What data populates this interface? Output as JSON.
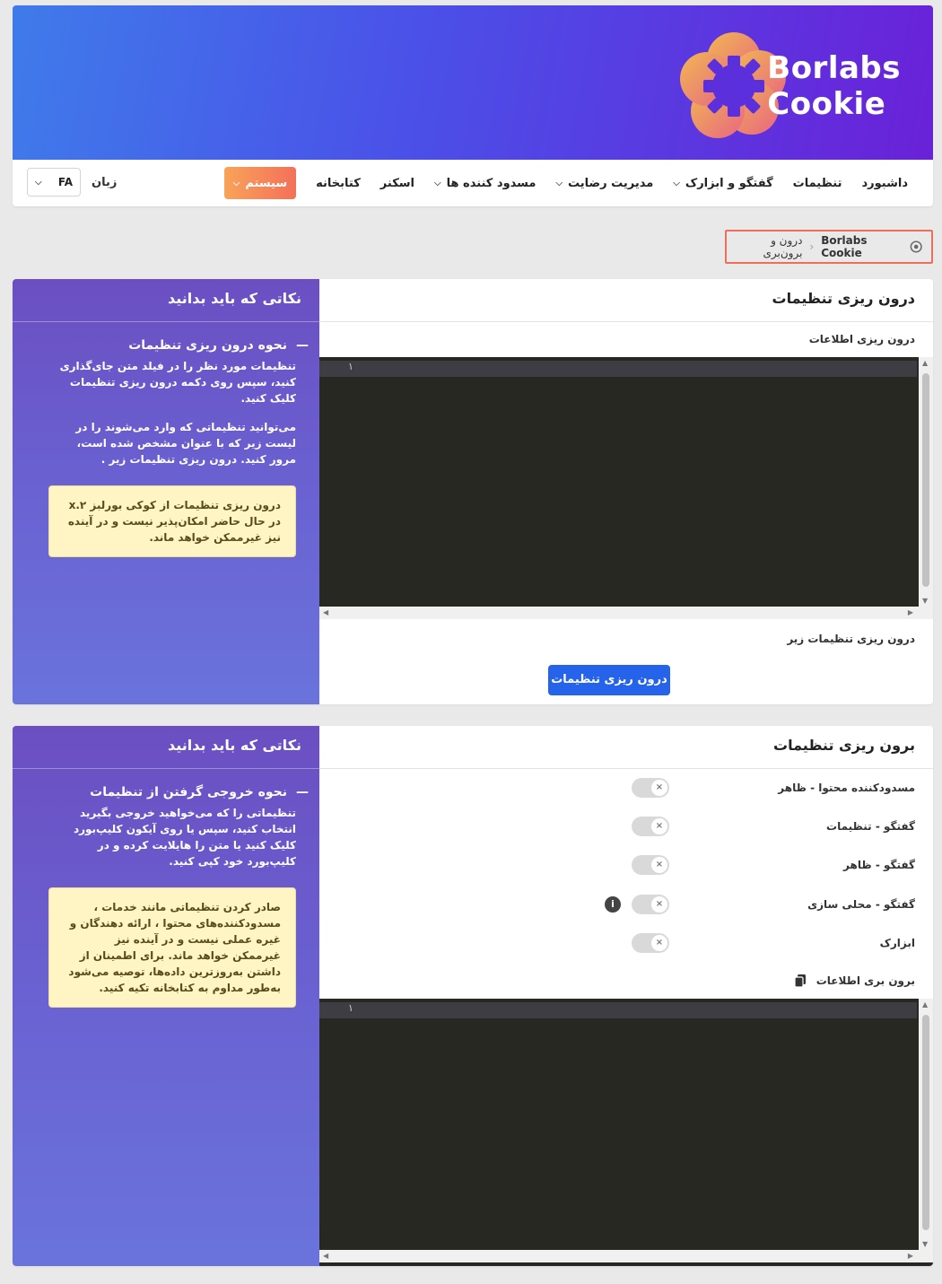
{
  "brand": {
    "name_line1": "Borlabs",
    "name_line2": "Cookie"
  },
  "nav": {
    "items": [
      {
        "label": "داشبورد",
        "dropdown": false,
        "active": false
      },
      {
        "label": "تنظیمات",
        "dropdown": false,
        "active": false
      },
      {
        "label": "گفتگو و ابزارک",
        "dropdown": true,
        "active": false
      },
      {
        "label": "مدیریت رضایت",
        "dropdown": true,
        "active": false
      },
      {
        "label": "مسدود کننده ها",
        "dropdown": true,
        "active": false
      },
      {
        "label": "اسکنر",
        "dropdown": false,
        "active": false
      },
      {
        "label": "کتابخانه",
        "dropdown": false,
        "active": false
      },
      {
        "label": "سیستم",
        "dropdown": true,
        "active": true
      }
    ],
    "language_label": "زبان",
    "language_value": "FA"
  },
  "breadcrumb": {
    "home": "Borlabs Cookie",
    "current": "درون و برون‌بری"
  },
  "import_card": {
    "title": "درون ریزی تنظیمات",
    "data_label": "درون ریزی اطلاعات",
    "line_number": "۱",
    "below_label": "درون ریزی تنظیمات زیر",
    "button_label": "درون ریزی تنظیمات",
    "side": {
      "title": "نکاتی که باید بدانید",
      "subtitle": "نحوه درون ریزی تنظیمات",
      "paragraph1": "تنظیمات مورد نظر را در فیلد متن جای‌گذاری کنید، سپس روی دکمه درون ریزی تنظیمات کلیک کنید.",
      "paragraph2": "می‌توانید تنظیماتی که وارد می‌شوند را در لیست زیر که با عنوان مشخص شده است، مرور کنید. درون ریزی تنظیمات زیر .",
      "note": "درون ریزی تنظیمات از کوکی بورلبز ۲.x در حال حاضر امکان‌پذیر نیست و در آینده نیز غیرممکن خواهد ماند."
    }
  },
  "export_card": {
    "title": "برون ریزی تنظیمات",
    "toggles": [
      {
        "label": "مسدودکننده محتوا - ظاهر",
        "info": false
      },
      {
        "label": "گفتگو - تنظیمات",
        "info": false
      },
      {
        "label": "گفتگو - ظاهر",
        "info": false
      },
      {
        "label": "گفتگو - محلی سازی",
        "info": true
      },
      {
        "label": "ابزارک",
        "info": false
      }
    ],
    "data_label": "برون بری اطلاعات",
    "line_number": "۱",
    "side": {
      "title": "نکاتی که باید بدانید",
      "subtitle": "نحوه خروجی گرفتن از تنظیمات",
      "paragraph1": "تنظیماتی را که می‌خواهید خروجی بگیرید انتخاب کنید، سپس یا روی آیکون کلیپ‌بورد کلیک کنید یا متن را هایلایت کرده و در کلیپ‌بورد خود کپی کنید.",
      "note": "صادر کردن تنظیماتی مانند خدمات ، مسدودکننده‌های محتوا ، ارائه دهندگان و غیره عملی نیست و در آینده نیز غیرممکن خواهد ماند. برای اطمینان از داشتن به‌روزترین داده‌ها، توصیه می‌شود به‌طور مداوم به کتابخانه تکیه کنید."
    }
  },
  "colors": {
    "header_gradient_start": "#3f7bea",
    "header_gradient_end": "#6a21d8",
    "active_nav": "#f4705a",
    "primary_button": "#2563eb",
    "sidebar": "#6a62d2",
    "note_bg": "#fff4c4",
    "editor_bg": "#272822"
  },
  "icons": {
    "logo": "borlabs-flower-logo",
    "breadcrumb_home": "gear-icon",
    "dropdown": "chevron-down-icon",
    "toggle": "x-icon",
    "info": "info-icon",
    "copy": "clipboard-icon"
  }
}
